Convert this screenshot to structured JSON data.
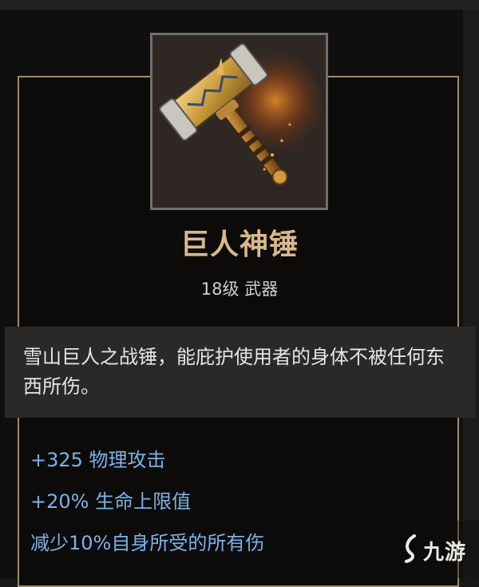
{
  "item": {
    "name": "巨人神锤",
    "meta": "18级 武器",
    "description": "雪山巨人之战锤，能庇护使用者的身体不被任何东西所伤。",
    "icon": "golden-war-hammer-icon"
  },
  "stats": [
    "+325 物理攻击",
    "+20% 生命上限值",
    "减少10%自身所受的所有伤"
  ],
  "watermark": {
    "text": "九游"
  },
  "colors": {
    "name": "#d8b88c",
    "stat": "#7ab3ea",
    "border": "#a08b5e",
    "panel": "#2a2927"
  }
}
